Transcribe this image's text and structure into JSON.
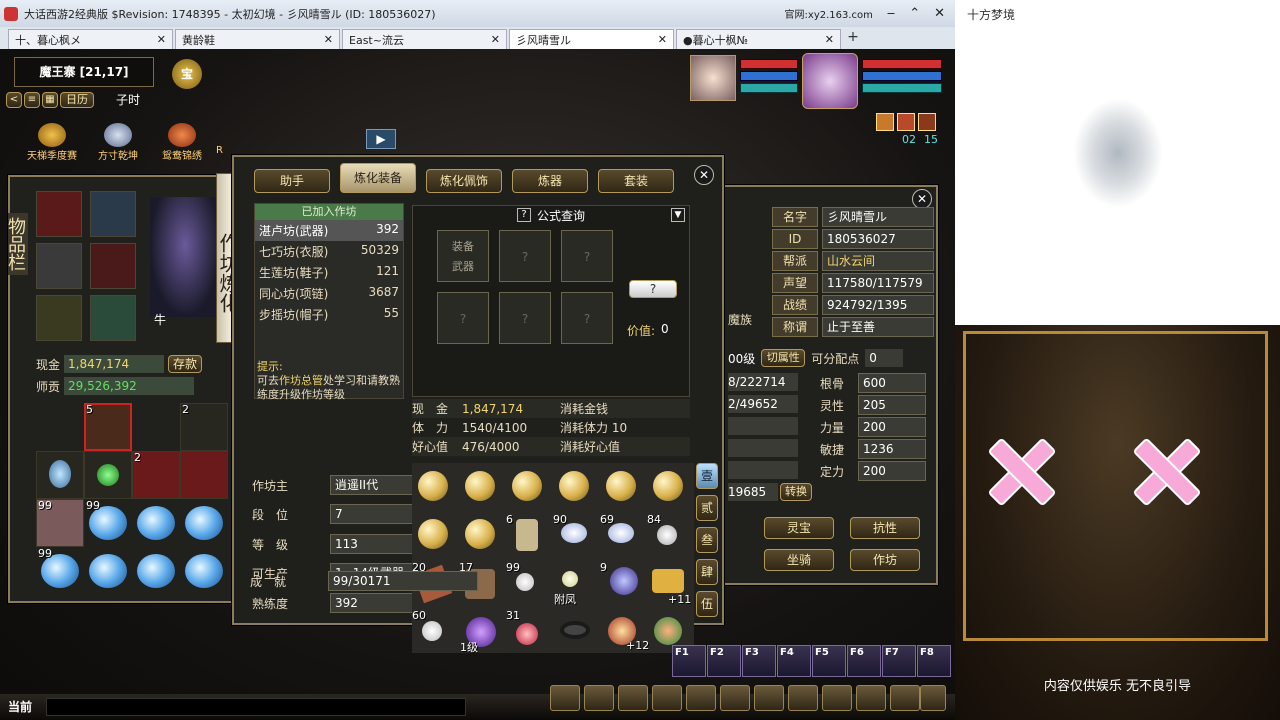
{
  "window": {
    "title": "大话西游2经典版 $Revision: 1748395 - 太初幻境 - 彡风晴雪ル (ID: 180536027)",
    "extra": "官网:xy2.163.com"
  },
  "tabs": [
    {
      "label": "十、暮心枫メ"
    },
    {
      "label": "黄龄鞋"
    },
    {
      "label": "East~流云"
    },
    {
      "label": "彡风晴雪ル"
    },
    {
      "label": "●暮心十枫№"
    }
  ],
  "hud": {
    "location": "魔王寨 [21,17]",
    "calendar": "日历",
    "time": "子时",
    "badge": "宝",
    "timer_a": "02",
    "timer_b": "15",
    "shortcuts": [
      {
        "label": "天梯季度赛"
      },
      {
        "label": "方寸乾坤"
      },
      {
        "label": "鸳鸯锦绣"
      },
      {
        "label": "R"
      }
    ]
  },
  "inventory": {
    "sidebar_label": "物品栏",
    "cash_label": "现金",
    "cash": "1,847,174",
    "deposit_btn": "存款",
    "debt_label": "师贡",
    "debt": "29,526,392",
    "char_name": "牛",
    "counts": [
      "5",
      "2",
      "2",
      "99",
      "99",
      "99",
      "99"
    ]
  },
  "craft": {
    "vertical_title": "作坊炼化",
    "tabs": [
      "助手",
      "炼化装备",
      "炼化佩饰",
      "炼器",
      "套装"
    ],
    "joined_header": "已加入作坊",
    "workshops": [
      {
        "name": "湛卢坊(武器)",
        "value": "392"
      },
      {
        "name": "七巧坊(衣服)",
        "value": "50329"
      },
      {
        "name": "生莲坊(鞋子)",
        "value": "121"
      },
      {
        "name": "同心坊(项链)",
        "value": "3687"
      },
      {
        "name": "步摇坊(帽子)",
        "value": "55"
      }
    ],
    "hint_title": "提示:",
    "hint_text_a": "可去",
    "hint_link": "作坊总管",
    "hint_text_b": "处学习和请教熟练度升级作坊等级",
    "formula_title": "公式查询",
    "slot_a": "装备",
    "slot_b": "武器",
    "slot_q": "?",
    "help_btn": "?",
    "price_label": "价值:",
    "price": "0",
    "stats": [
      {
        "label": "现　金",
        "value": "1,847,174",
        "cost": "消耗金钱"
      },
      {
        "label": "体　力",
        "value": "1540/4100",
        "cost": "消耗体力 10"
      },
      {
        "label": "好心值",
        "value": "476/4000",
        "cost": "消耗好心值"
      }
    ],
    "fields": [
      {
        "label": "作坊主",
        "value": "逍遥II代"
      },
      {
        "label": "段　位",
        "value": "7"
      },
      {
        "label": "等　级",
        "value": "113"
      },
      {
        "label": "可生产",
        "value": "1~14级武器"
      },
      {
        "label": "熟练度",
        "value": "392"
      },
      {
        "label": "成　就",
        "value": "99/30171"
      }
    ],
    "grid_counts": [
      "6",
      "90",
      "69",
      "84",
      "20",
      "17",
      "99",
      "9",
      "60",
      "31"
    ],
    "grid_labels": [
      "附凤",
      "+11",
      "1级",
      "+12"
    ],
    "side_tabs": [
      "壹",
      "贰",
      "叁",
      "肆",
      "伍"
    ]
  },
  "profile": {
    "rows": [
      {
        "label": "名字",
        "value": "彡风晴雪ル"
      },
      {
        "label": "ID",
        "value": "180536027"
      },
      {
        "label": "帮派",
        "value": "山水云间"
      },
      {
        "label": "声望",
        "value": "117580/117579"
      },
      {
        "label": "战绩",
        "value": "924792/1395"
      },
      {
        "label": "称谓",
        "value": "止于至善"
      }
    ],
    "level": "00级",
    "switch_btn": "切属性",
    "points_label": "可分配点",
    "points": "0",
    "partial": [
      "8/222714",
      "2/49652",
      "19685"
    ],
    "transfer_btn": "转换",
    "attrs": [
      {
        "label": "根骨",
        "value": "600"
      },
      {
        "label": "灵性",
        "value": "205"
      },
      {
        "label": "力量",
        "value": "200"
      },
      {
        "label": "敏捷",
        "value": "1236"
      },
      {
        "label": "定力",
        "value": "200"
      }
    ],
    "race": "魔族",
    "buttons": [
      "灵宝",
      "抗性",
      "坐骑",
      "作坊"
    ]
  },
  "bottom": {
    "chat_label": "当前",
    "fkeys": [
      "F1",
      "F2",
      "F3",
      "F4",
      "F5",
      "F6",
      "F7",
      "F8"
    ]
  },
  "stream": {
    "channel": "十方梦境",
    "disclaimer": "内容仅供娱乐 无不良引导"
  }
}
